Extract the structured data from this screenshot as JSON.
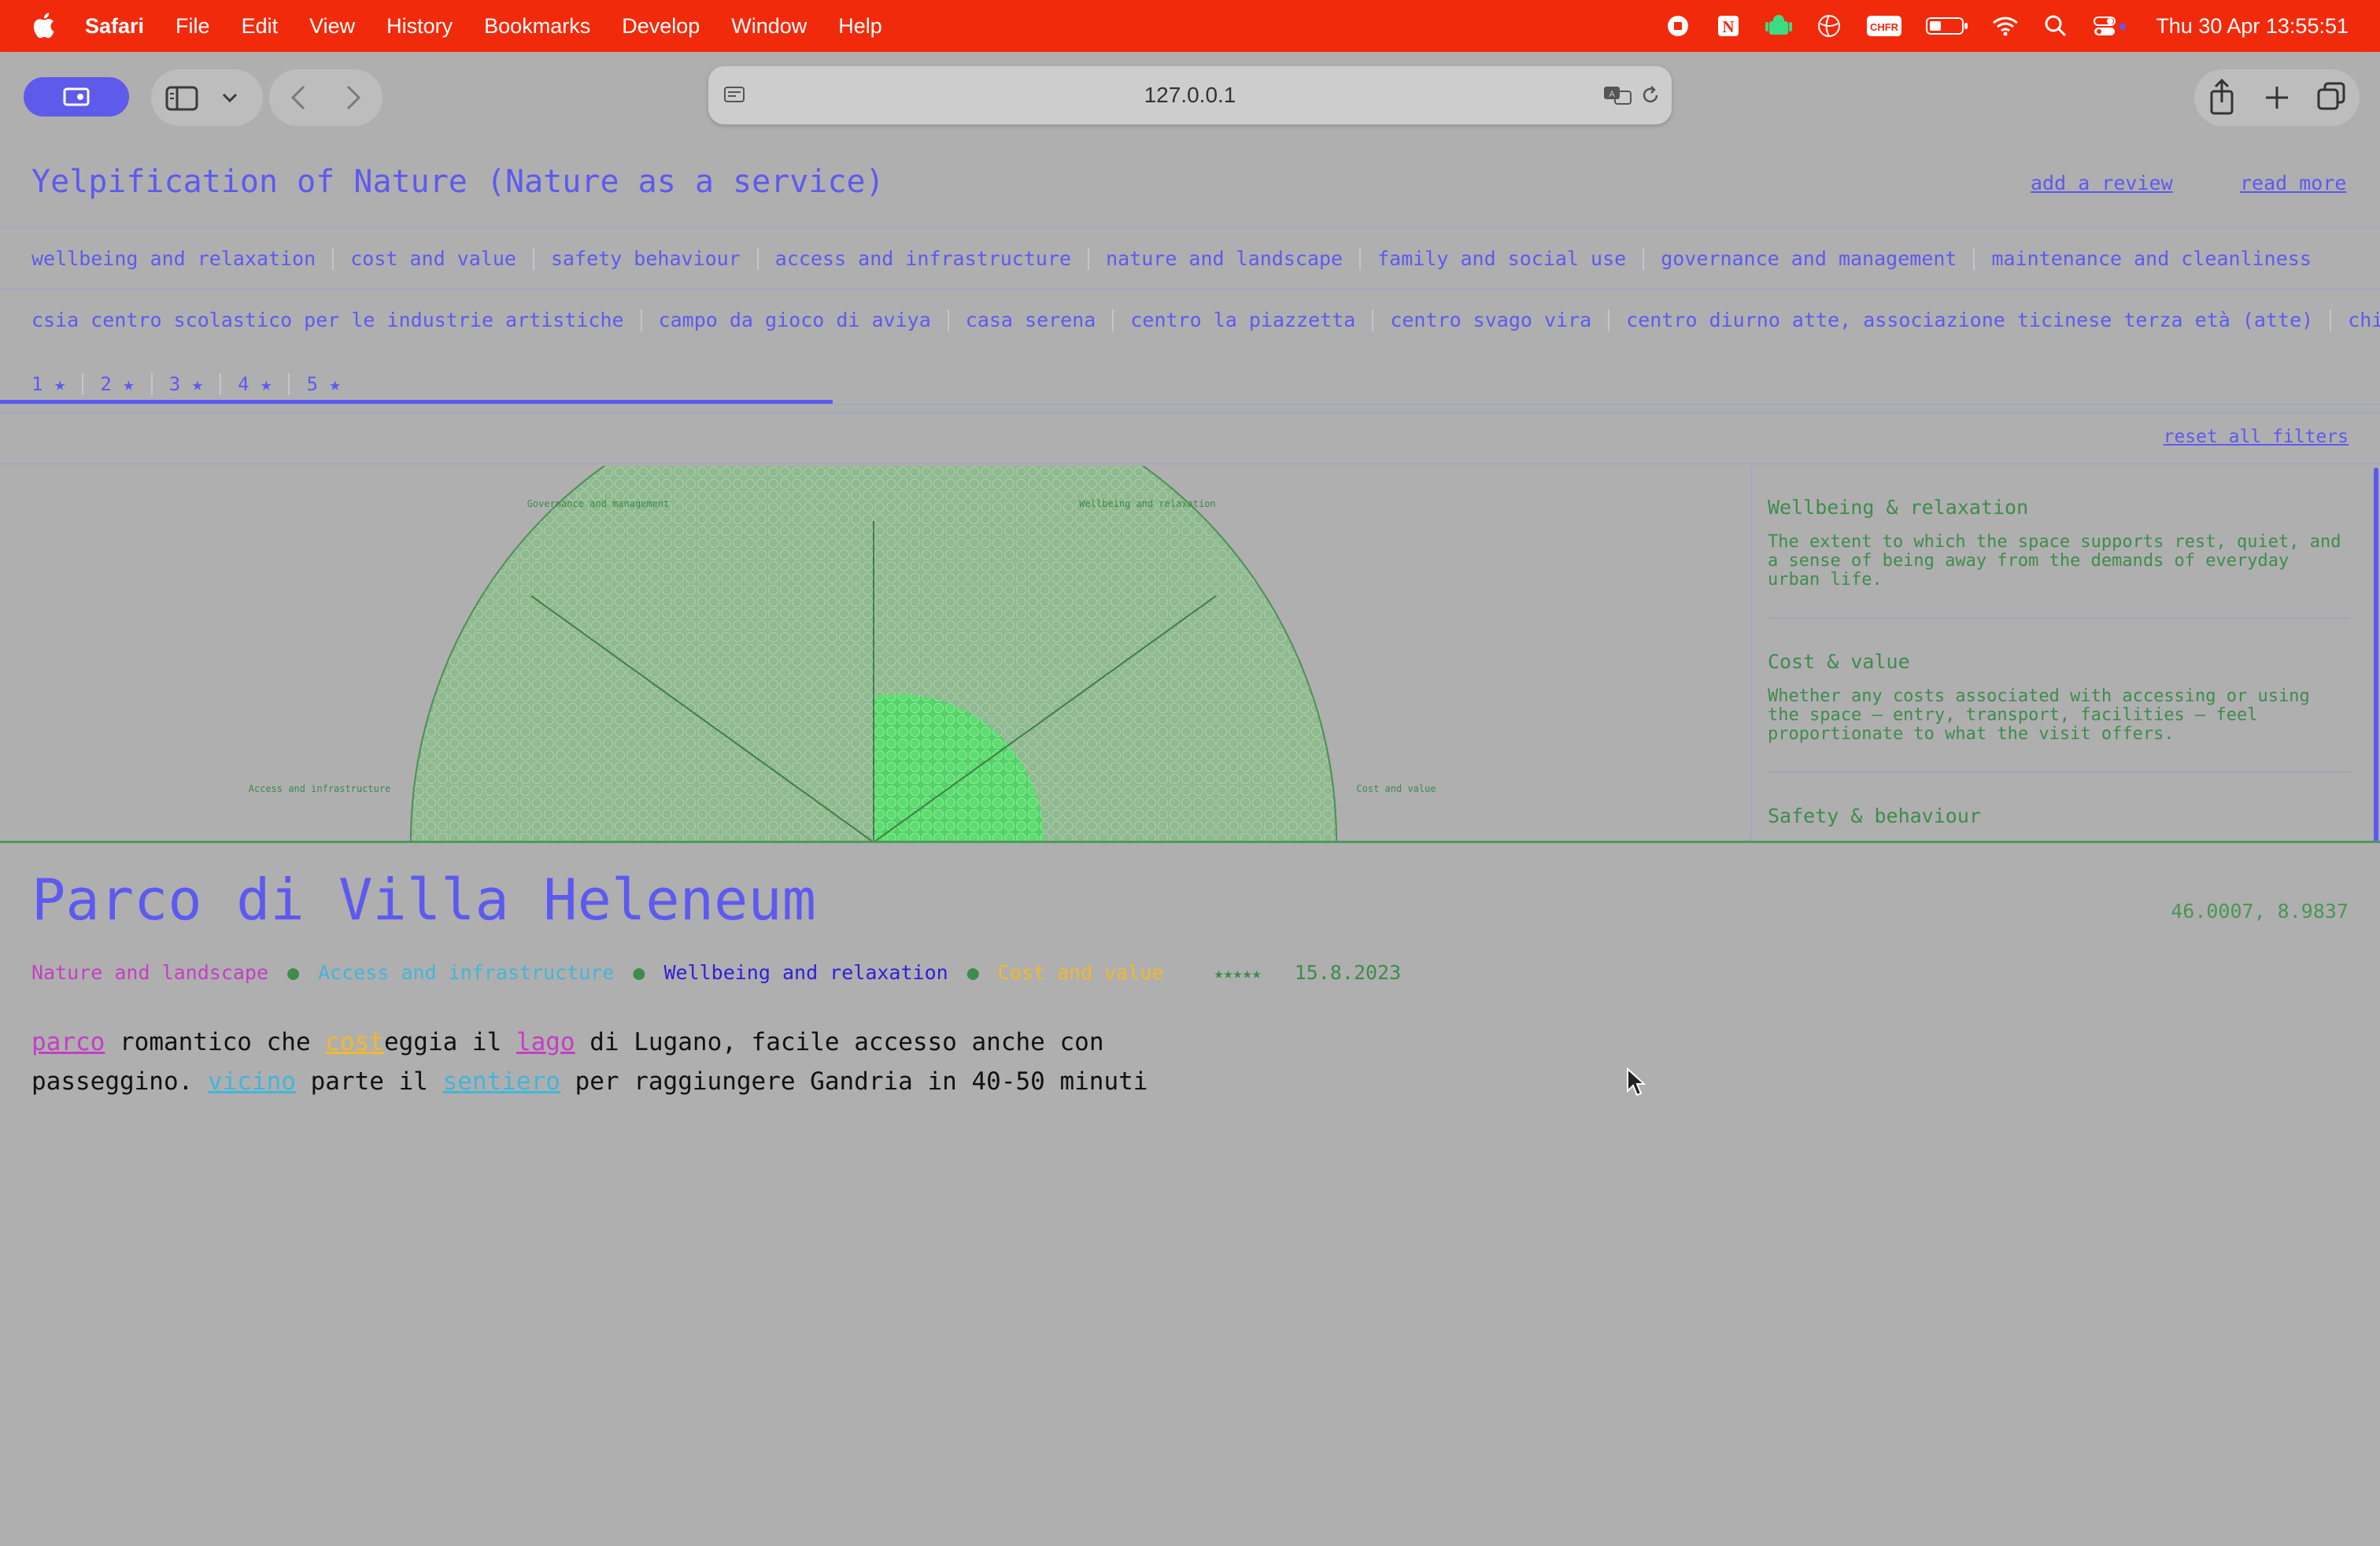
{
  "menubar": {
    "app": "Safari",
    "items": [
      "File",
      "Edit",
      "View",
      "History",
      "Bookmarks",
      "Develop",
      "Window",
      "Help"
    ],
    "status_icons": [
      "stop-record-icon",
      "notion-icon",
      "android-icon",
      "vpn-globe-icon",
      "chfr-icon",
      "battery-icon",
      "wifi-icon",
      "spotlight-search-icon",
      "control-center-icon"
    ],
    "chfr_label": "CHFR",
    "clock": "Thu 30 Apr  13:55:51"
  },
  "browser": {
    "url": "127.0.0.1"
  },
  "site": {
    "title": "Yelpification of Nature (Nature as a service)",
    "add_review": "add a review",
    "read_more": "read more",
    "reset_filters": "reset all filters"
  },
  "categories": [
    "wellbeing and relaxation",
    "cost and value",
    "safety behaviour",
    "access and infrastructure",
    "nature and landscape",
    "family and social use",
    "governance and management",
    "maintenance and cleanliness"
  ],
  "places": [
    "csia centro scolastico per le industrie artistiche",
    "campo da gioco di aviya",
    "casa serena",
    "centro la piazzetta",
    "centro svago vira",
    "centro diurno atte, associazione ticinese terza età (atte)",
    "chiesa santa"
  ],
  "star_filters": [
    "1 ★",
    "2 ★",
    "3 ★",
    "4 ★",
    "5 ★"
  ],
  "chart_labels": {
    "governance": "Governance and management",
    "wellbeing": "Wellbeing and relaxation",
    "access": "Access and infrastructure",
    "cost": "Cost and value"
  },
  "definitions": [
    {
      "title": "Wellbeing & relaxation",
      "text": "The extent to which the space supports rest, quiet, and a sense of being away from the demands of everyday urban life."
    },
    {
      "title": "Cost & value",
      "text": "Whether any costs associated with accessing or using the space — entry, transport, facilities — feel proportionate to what the visit offers."
    },
    {
      "title": "Safety & behaviour",
      "text": ""
    }
  ],
  "detail": {
    "name": "Parco di Villa Heleneum",
    "coords": "46.0007, 8.9837",
    "tags": [
      {
        "label": "Nature and landscape",
        "color": "#c43fc4"
      },
      {
        "label": "Access and infrastructure",
        "color": "#45b5d8"
      },
      {
        "label": "Wellbeing and relaxation",
        "color": "#2e1fd8"
      },
      {
        "label": "Cost and value",
        "color": "#f2b92a"
      }
    ],
    "stars": "★★★★★",
    "date": "15.8.2023",
    "review": {
      "w1": "parco",
      "t1": " romantico che ",
      "w2": "cost",
      "t2": "eggia il ",
      "w3": "lago",
      "t3": " di Lugano, facile accesso anche con",
      "t4": "passeggino. ",
      "w4": "vicino",
      "t5": " parte il ",
      "w5": "sentiero",
      "t6": " per raggiungere Gandria in 40-50 minuti"
    }
  },
  "colors": {
    "accent": "#5d5af0",
    "green": "#3e8c4b",
    "menubar": "#f22a0c"
  }
}
